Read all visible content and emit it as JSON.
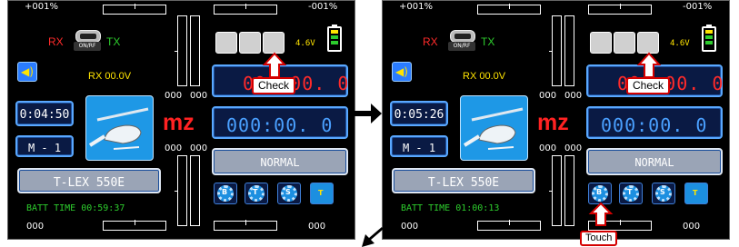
{
  "screens": [
    {
      "trim_top_left": "+001%",
      "trim_top_right": "-001%",
      "rx_label": "RX",
      "tx_label": "TX",
      "onrf_label": "ON/RF",
      "voltage": "4.6V",
      "rx_voltage": "RX 00.0V",
      "timer": "0:04:50",
      "model_slot": "M - 1",
      "model_name": "T-LEX 550E",
      "mode_label": "mz",
      "top_timer": "000:00. 0",
      "bottom_timer": "000:00. 0",
      "flight_mode": "NORMAL",
      "batt_time": "BATT TIME  00:59:37",
      "trim_left_top": "000",
      "trim_right_top": "000",
      "trim_left_bottom": "000",
      "trim_right_bottom": "000",
      "trim_bottom_left": "000",
      "trim_bottom_right": "000",
      "callout": "Check",
      "gear_letters": [
        "B",
        "T",
        "S",
        "T"
      ]
    },
    {
      "trim_top_left": "+001%",
      "trim_top_right": "-001%",
      "rx_label": "RX",
      "tx_label": "TX",
      "onrf_label": "ON/RF",
      "voltage": "4.6V",
      "rx_voltage": "RX 00.0V",
      "timer": "0:05:26",
      "model_slot": "M - 1",
      "model_name": "T-LEX 550E",
      "mode_label": "mz",
      "top_timer": "000:00. 0",
      "bottom_timer": "000:00. 0",
      "flight_mode": "NORMAL",
      "batt_time": "BATT TIME  01:00:13",
      "trim_left_top": "000",
      "trim_right_top": "000",
      "trim_left_bottom": "000",
      "trim_right_bottom": "000",
      "trim_bottom_left": "000",
      "trim_bottom_right": "000",
      "callout": "Check",
      "touch_callout": "Touch",
      "gear_letters": [
        "B",
        "T",
        "S",
        "T"
      ]
    }
  ],
  "colors": {
    "screen_bg": "#000000",
    "accent_blue": "#5aa8ff",
    "alert_red": "#ff2222",
    "voltage_yellow": "#ffe400",
    "ok_green": "#2dcc2d"
  },
  "icons": [
    "headphone-icon",
    "lock-icon",
    "sd-card-icon",
    "battery-icon",
    "speaker-icon",
    "helicopter-icon",
    "gear-icon",
    "flow-arrow-right-icon",
    "flow-arrow-down-left-icon"
  ]
}
